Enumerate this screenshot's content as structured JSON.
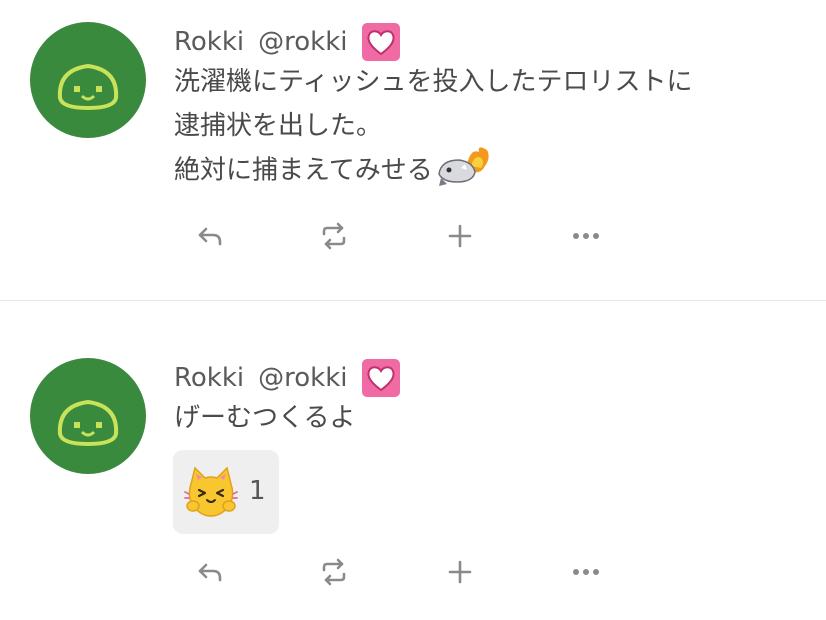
{
  "notes": [
    {
      "display_name": "Rokki",
      "username": "@rokki",
      "lines": [
        "洗濯機にティッシュを投入したテロリストに",
        "逮捕状を出した。",
        "絶対に捕まえてみせる"
      ],
      "emoji_icon": "burning-creature-icon",
      "actions": [
        "reply-icon",
        "renote-icon",
        "plus-icon",
        "more-icon"
      ]
    },
    {
      "display_name": "Rokki",
      "username": "@rokki",
      "lines": [
        "げーむつくるよ"
      ],
      "reaction": {
        "emoji_icon": "excited-cat-icon",
        "count": "1"
      },
      "actions": [
        "reply-icon",
        "renote-icon",
        "plus-icon",
        "more-icon"
      ]
    }
  ],
  "colors": {
    "avatar_bg": "#3a8a3e",
    "avatar_face": "#c8e25a",
    "badge_bg": "#f06aa4",
    "icon_gray": "#8a8a8a",
    "reaction_bg": "#efefef"
  }
}
